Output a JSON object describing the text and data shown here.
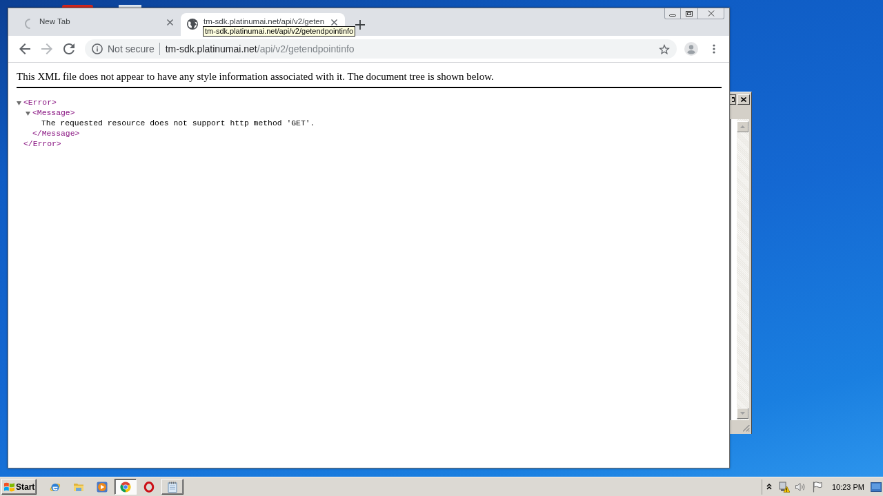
{
  "tabs": [
    {
      "title": "New Tab",
      "selected": false,
      "loading": true
    },
    {
      "title": "tm-sdk.platinumai.net/api/v2/geten",
      "selected": true,
      "loading": false
    }
  ],
  "tooltip": {
    "text": "tm-sdk.platinumai.net/api/v2/getendpointinfo"
  },
  "toolbar": {
    "buttons": [
      {
        "kind": "back",
        "disabled": false
      },
      {
        "kind": "forward",
        "disabled": true
      },
      {
        "kind": "reload",
        "disabled": false
      }
    ]
  },
  "address_bar": {
    "security": "Not secure",
    "host": "tm-sdk.platinumai.net",
    "path": "/api/v2/getendpointinfo",
    "bookmarked": false
  },
  "page": {
    "notice": "This XML file does not appear to have any style information associated with it. The document tree is shown below.",
    "tree": {
      "kind": "element",
      "open_tag": "<Error>",
      "close_tag": "</Error>",
      "expanded": true,
      "children": [
        {
          "kind": "element",
          "open_tag": "<Message>",
          "close_tag": "</Message>",
          "expanded": true,
          "children": [
            {
              "kind": "text",
              "text": "The requested resource does not support http method 'GET'."
            }
          ]
        }
      ]
    }
  },
  "taskbar": {
    "start_label": "Start",
    "items": [
      {
        "kind": "ie",
        "selected": false,
        "window_open": false
      },
      {
        "kind": "folder",
        "selected": false,
        "window_open": false
      },
      {
        "kind": "media",
        "selected": false,
        "window_open": false
      },
      {
        "kind": "chrome",
        "selected": true,
        "window_open": true
      },
      {
        "kind": "opera",
        "selected": false,
        "window_open": false
      },
      {
        "kind": "notepad",
        "selected": false,
        "window_open": true
      }
    ],
    "clock": "10:23 PM"
  }
}
